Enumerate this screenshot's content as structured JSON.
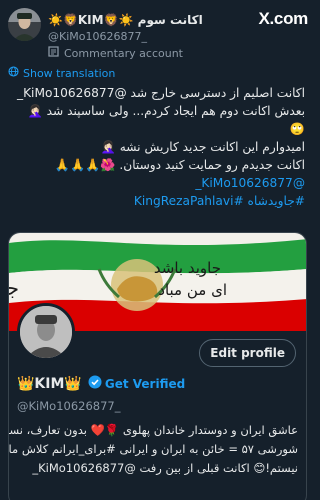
{
  "header": {
    "display_name": "☀️🦁KIM🦁☀️ اکانت سوم",
    "handle": "@KiMo10626877_",
    "account_type": "Commentary account",
    "logo_text": "X.com"
  },
  "translate": {
    "label": "Show translation"
  },
  "tweet": {
    "line1": "اکانت اصلیم از دسترسی خارج شد @KiMo10626877_",
    "line2": "بعدش اکانت دوم هم ایجاد کردم... ولی ساسپند شد 🤦🏻‍♀️",
    "line3": "🙄",
    "line4": "امیدوارم این اکانت جدید کاریش نشه 🤦🏻‍♀️",
    "line5": "اکانت جدیدم رو حمایت کنید دوستان. 🌺🙏🙏🙏",
    "mention": "@KiMo10626877_",
    "hashtags": "#جاویدشاه #KingRezaPahlavi"
  },
  "card": {
    "banner_text_right": "جاوید باشد",
    "banner_text_right2": "ای من مباد",
    "banner_text_left": "جاویدشاه",
    "edit_button": "Edit profile",
    "name": "👑KIM👑",
    "verified_label": "Get Verified",
    "handle": "@KiMo10626877_",
    "bio_line1": "عاشق ایران و دوستدار خاندان پهلوی 🌹❤️ بدون تعارف، نسل",
    "bio_line2": "شورشی ۵۷ = خائن به ایران و ایرانی #برای_ایرانم کلاش مال",
    "bio_line3": "نیستم!😊 اکانت قبلی از بین رفت @KiMo10626877_"
  },
  "colors": {
    "background": "#15202b",
    "accent": "#1d9bf0",
    "muted": "#8b98a5",
    "flag_green": "#239f40",
    "flag_red": "#da0000"
  }
}
